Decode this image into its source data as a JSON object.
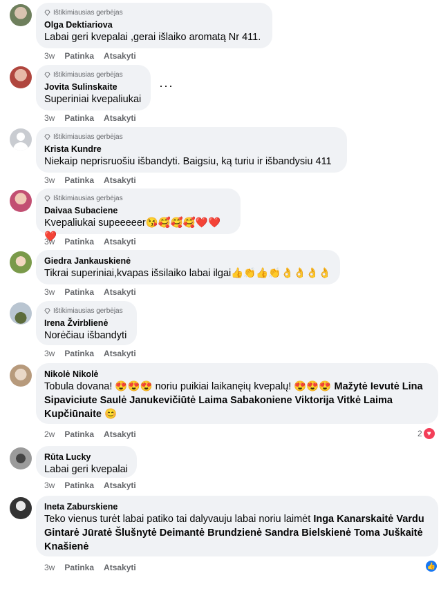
{
  "badge_label": "Ištikimiausias gerbėjas",
  "action_like": "Patinka",
  "action_reply": "Atsakyti",
  "colors": {
    "bubble": "#f0f2f5",
    "secondary_text": "#65676b",
    "heart": "#f33e58",
    "like": "#1877f2"
  },
  "comments": [
    {
      "author": "Olga Dektiariova",
      "badge": true,
      "text": "Labai geri kvepalai ,gerai išlaiko aromatą Nr 411.",
      "time": "3w"
    },
    {
      "author": "Jovita Sulinskaite",
      "badge": true,
      "text": "Superiniai kvepaliukai",
      "time": "3w",
      "more": "···"
    },
    {
      "author": "Krista Kundre",
      "badge": true,
      "text": "Niekaip neprisruošiu išbandyti. Baigsiu, ką turiu ir išbandysiu 411",
      "time": "3w"
    },
    {
      "author": "Daivaa Subaciene",
      "badge": true,
      "text": "Kvepaliukai supeeeeer😘🥰🥰🥰❤️❤️❤️",
      "time": "3w"
    },
    {
      "author": "Giedra Jankauskienė",
      "badge": false,
      "text": "Tikrai superiniai,kvapas išsilaiko labai ilgai👍👏👍👏👌👌👌👌",
      "time": "3w"
    },
    {
      "author": "Irena Žvirblienė",
      "badge": true,
      "text": "Norėčiau išbandyti",
      "time": "3w"
    },
    {
      "author": "Nikolė Nikolė",
      "badge": false,
      "text_pre": "Tobula dovana! 😍😍😍 noriu puikiai laikanęių kvepalų! 😍😍😍 ",
      "mentions": "Mažytė Ievutė Lina Sipaviciute Saulė Janukevičiūtė Laima Sabakoniene Viktorija Vitkė Laima Kupčiūnaite",
      "text_post": " 😊",
      "time": "2w",
      "reaction_count": "2"
    },
    {
      "author": "Rūta Lucky",
      "badge": false,
      "text": "Labai geri kvepalai",
      "time": "3w"
    },
    {
      "author": "Ineta Zaburskiene",
      "badge": false,
      "text_pre": "Teko vienus turėt labai patiko tai dalyvauju labai noriu laimėt ",
      "mentions": "Inga Kanarskaitė Vardu Gintarė Jūratė Šlušnytė Deimantė Brundzienė Sandra Bielskienė Toma Juškaitė Knašienė",
      "time": "3w"
    }
  ]
}
